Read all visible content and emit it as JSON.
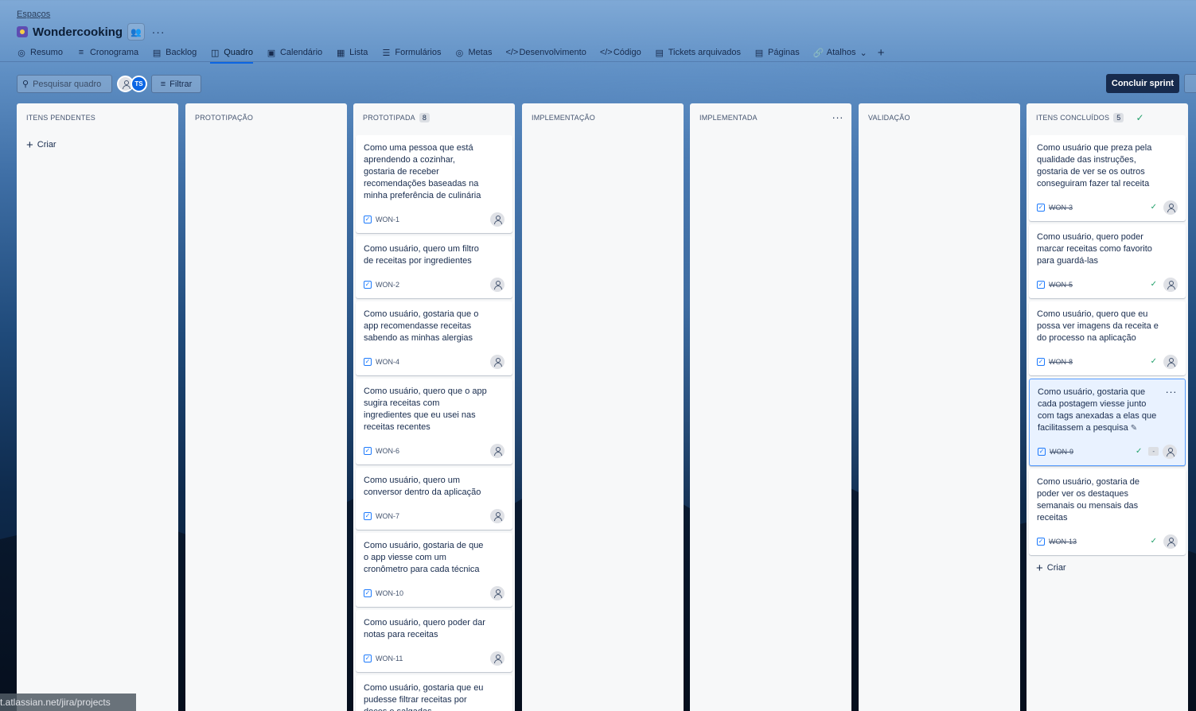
{
  "breadcrumb": "Espaços",
  "project": {
    "title": "Wondercooking"
  },
  "tabs": [
    {
      "label": "Resumo",
      "icon": "globe-icon"
    },
    {
      "label": "Cronograma",
      "icon": "timeline-icon"
    },
    {
      "label": "Backlog",
      "icon": "backlog-icon"
    },
    {
      "label": "Quadro",
      "icon": "board-icon",
      "active": true
    },
    {
      "label": "Calendário",
      "icon": "calendar-icon"
    },
    {
      "label": "Lista",
      "icon": "list-icon"
    },
    {
      "label": "Formulários",
      "icon": "forms-icon"
    },
    {
      "label": "Metas",
      "icon": "goals-icon"
    },
    {
      "label": "Desenvolvimento",
      "icon": "code-icon"
    },
    {
      "label": "Código",
      "icon": "code-icon"
    },
    {
      "label": "Tickets arquivados",
      "icon": "archive-icon"
    },
    {
      "label": "Páginas",
      "icon": "pages-icon"
    },
    {
      "label": "Atalhos",
      "icon": "link-icon"
    }
  ],
  "toolbar": {
    "search_placeholder": "Pesquisar quadro",
    "avatar_initials": "TS",
    "filter_label": "Filtrar",
    "complete_label": "Concluir sprint"
  },
  "columns": [
    {
      "title": "ITENS PENDENTES",
      "count": "",
      "create_label": "Criar",
      "cards": []
    },
    {
      "title": "PROTOTIPAÇÃO",
      "count": "",
      "cards": []
    },
    {
      "title": "PROTOTIPADA",
      "count": "8",
      "cards": [
        {
          "text": "Como uma pessoa que está aprendendo a cozinhar, gostaria de receber recomendações baseadas na minha preferência de culinária",
          "key": "WON-1"
        },
        {
          "text": "Como usuário, quero um filtro de receitas por ingredientes",
          "key": "WON-2"
        },
        {
          "text": "Como usuário, gostaria que o app recomendasse receitas sabendo as minhas alergias",
          "key": "WON-4"
        },
        {
          "text": "Como usuário, quero que o app sugira receitas com ingredientes que eu usei nas receitas recentes",
          "key": "WON-6"
        },
        {
          "text": "Como usuário, quero um conversor dentro da aplicação",
          "key": "WON-7"
        },
        {
          "text": "Como usuário, gostaria de que o app viesse com um cronômetro para cada técnica",
          "key": "WON-10"
        },
        {
          "text": "Como usuário, quero poder dar notas para receitas",
          "key": "WON-11"
        },
        {
          "text": "Como usuário, gostaria que eu pudesse filtrar receitas por doces e salgadas",
          "key": ""
        }
      ]
    },
    {
      "title": "IMPLEMENTAÇÃO",
      "count": "",
      "cards": []
    },
    {
      "title": "IMPLEMENTADA",
      "count": "",
      "cards": []
    },
    {
      "title": "VALIDAÇÃO",
      "count": "",
      "cards": []
    },
    {
      "title": "ITENS CONCLUÍDOS",
      "count": "5",
      "create_label": "Criar",
      "cards": [
        {
          "text": "Como usuário que preza pela qualidade das instruções, gostaria de ver se os outros conseguiram fazer tal receita",
          "key": "WON-3"
        },
        {
          "text": "Como usuário, quero poder marcar receitas como favorito para guardá-las",
          "key": "WON-5"
        },
        {
          "text": "Como usuário, quero que eu possa ver imagens da receita e do processo na aplicação",
          "key": "WON-8"
        },
        {
          "text": "Como usuário, gostaria que cada postagem viesse junto com tags anexadas a elas que facilitassem a pesquisa",
          "key": "WON-9",
          "selected": true,
          "estimate": "-"
        },
        {
          "text": "Como usuário, gostaria de poder ver os destaques semanais ou mensais das receitas",
          "key": "WON-13"
        }
      ]
    }
  ],
  "statusbar": {
    "url": "t.atlassian.net/jira/projects"
  }
}
